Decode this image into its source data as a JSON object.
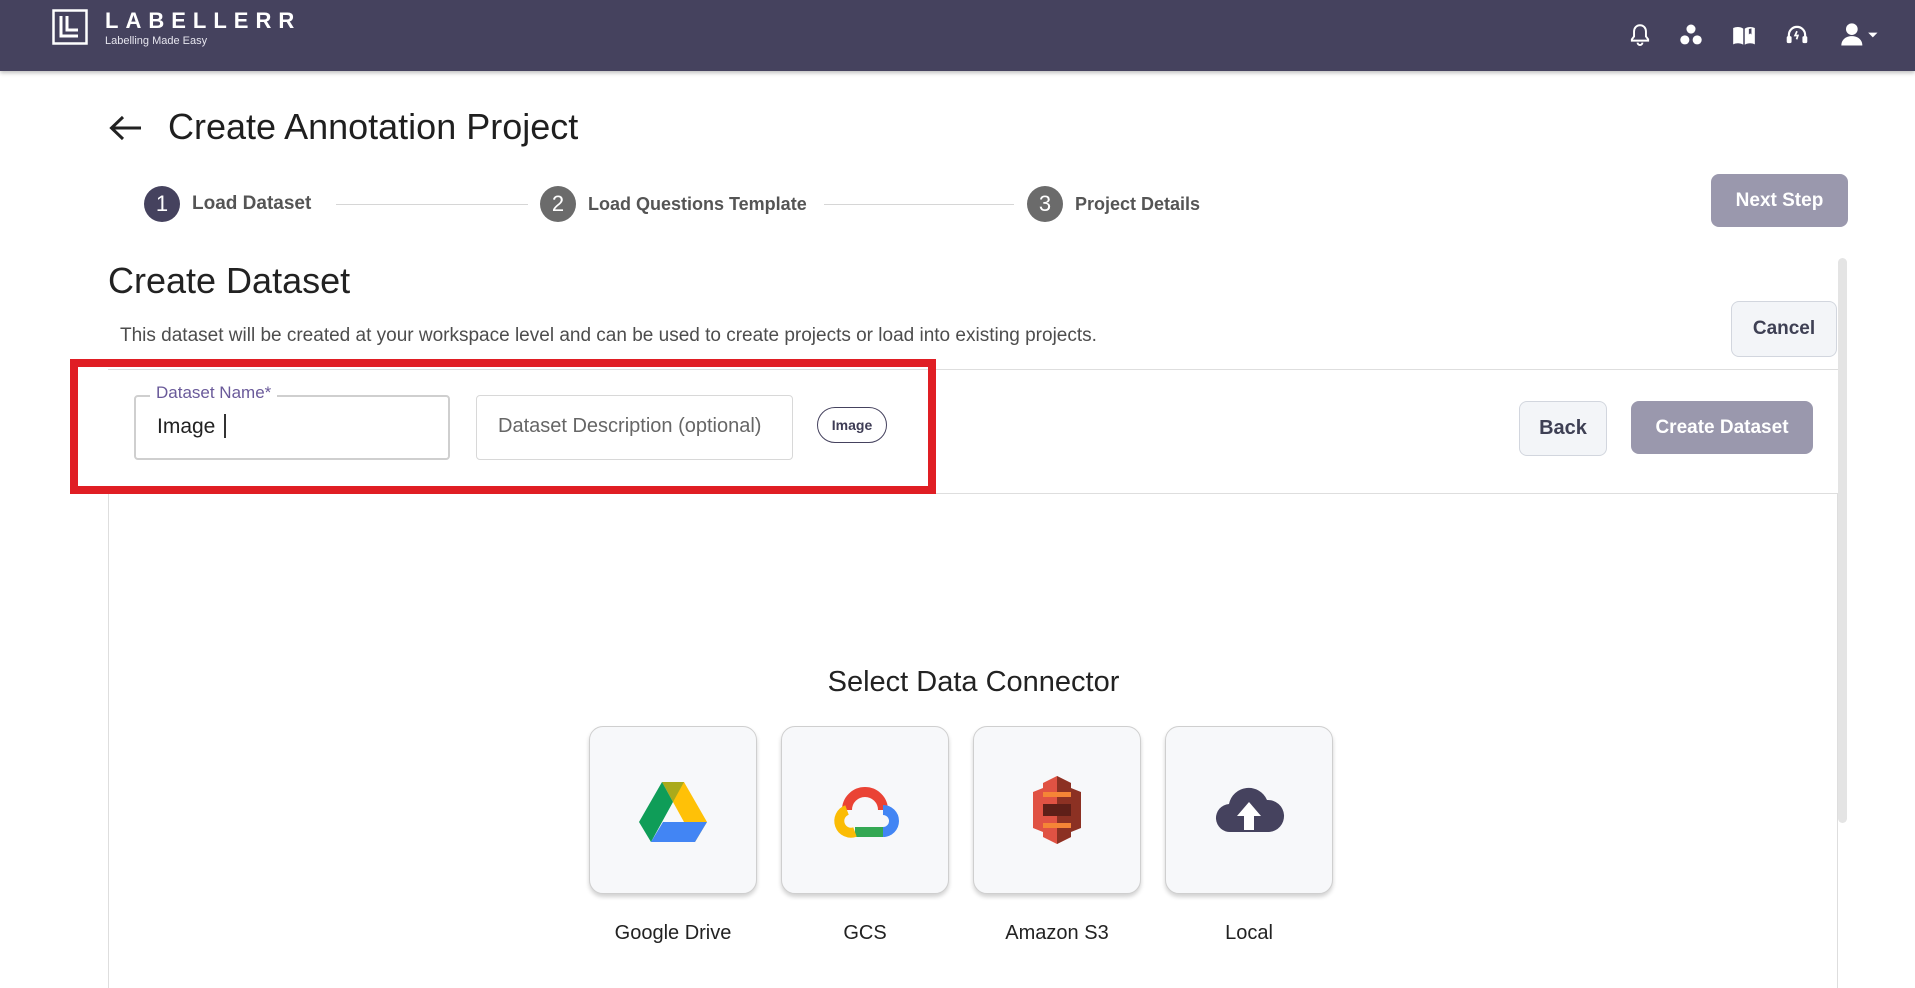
{
  "app": {
    "name": "LABELLERR",
    "tagline": "Labelling Made Easy"
  },
  "header": {
    "title": "Create Annotation Project"
  },
  "stepper": {
    "steps": [
      {
        "number": "1",
        "label": "Load Dataset",
        "state": "active"
      },
      {
        "number": "2",
        "label": "Load Questions Template",
        "state": "inactive"
      },
      {
        "number": "3",
        "label": "Project Details",
        "state": "inactive"
      }
    ],
    "next_label": "Next Step"
  },
  "dataset": {
    "title": "Create Dataset",
    "description": "This dataset will be created at your workspace level and can be used to create projects or load into existing projects.",
    "cancel_label": "Cancel",
    "name_label": "Dataset Name*",
    "name_value": "Image",
    "description_placeholder": "Dataset Description (optional)",
    "type_chip": "Image",
    "back_label": "Back",
    "create_label": "Create Dataset"
  },
  "connectors": {
    "title": "Select Data Connector",
    "items": [
      {
        "label": "Google Drive",
        "icon": "google-drive-icon"
      },
      {
        "label": "GCS",
        "icon": "google-cloud-icon"
      },
      {
        "label": "Amazon S3",
        "icon": "amazon-s3-icon"
      },
      {
        "label": "Local",
        "icon": "cloud-upload-icon"
      }
    ]
  },
  "colors": {
    "topbar": "#45425e",
    "accent": "#6a5a9a",
    "button_disabled": "#9a98ad",
    "highlight": "#e01e24"
  }
}
